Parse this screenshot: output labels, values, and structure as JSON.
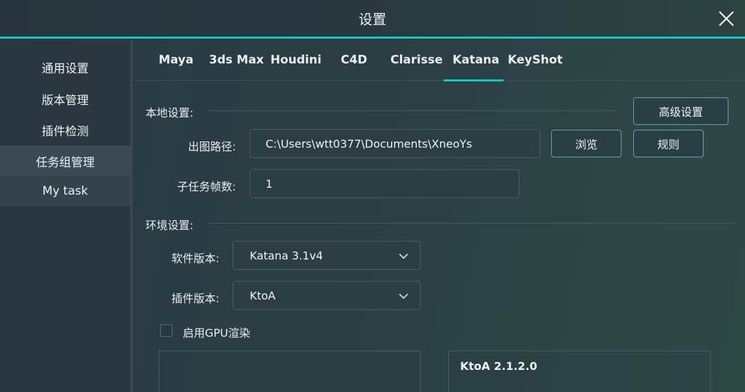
{
  "window": {
    "title": "设置"
  },
  "sidebar": {
    "items": [
      {
        "label": "通用设置"
      },
      {
        "label": "版本管理"
      },
      {
        "label": "插件检测"
      },
      {
        "label": "任务组管理"
      },
      {
        "label": "My task"
      }
    ]
  },
  "tabs": [
    {
      "label": "Maya"
    },
    {
      "label": "3ds Max"
    },
    {
      "label": "Houdini"
    },
    {
      "label": "C4D"
    },
    {
      "label": "Clarisse"
    },
    {
      "label": "Katana"
    },
    {
      "label": "KeyShot"
    }
  ],
  "active_tab": "Katana",
  "local_settings": {
    "section_label": "本地设置:",
    "advanced_button": "高级设置",
    "output_path_label": "出图路径:",
    "output_path_value": "C:\\Users\\wtt0377\\Documents\\XneoYs",
    "browse_button": "浏览",
    "rules_button": "规则",
    "subtask_frames_label": "子任务帧数:",
    "subtask_frames_value": "1"
  },
  "env_settings": {
    "section_label": "环境设置:",
    "software_version_label": "软件版本:",
    "software_version_value": "Katana 3.1v4",
    "plugin_version_label": "插件版本:",
    "plugin_version_value": "KtoA",
    "gpu_checkbox_label": "启用GPU渲染",
    "plugin_list_item": "KtoA 2.1.2.0"
  },
  "colors": {
    "accent": "#17c6c6",
    "background": "#2b3d43",
    "sidebar": "#2a3640"
  }
}
